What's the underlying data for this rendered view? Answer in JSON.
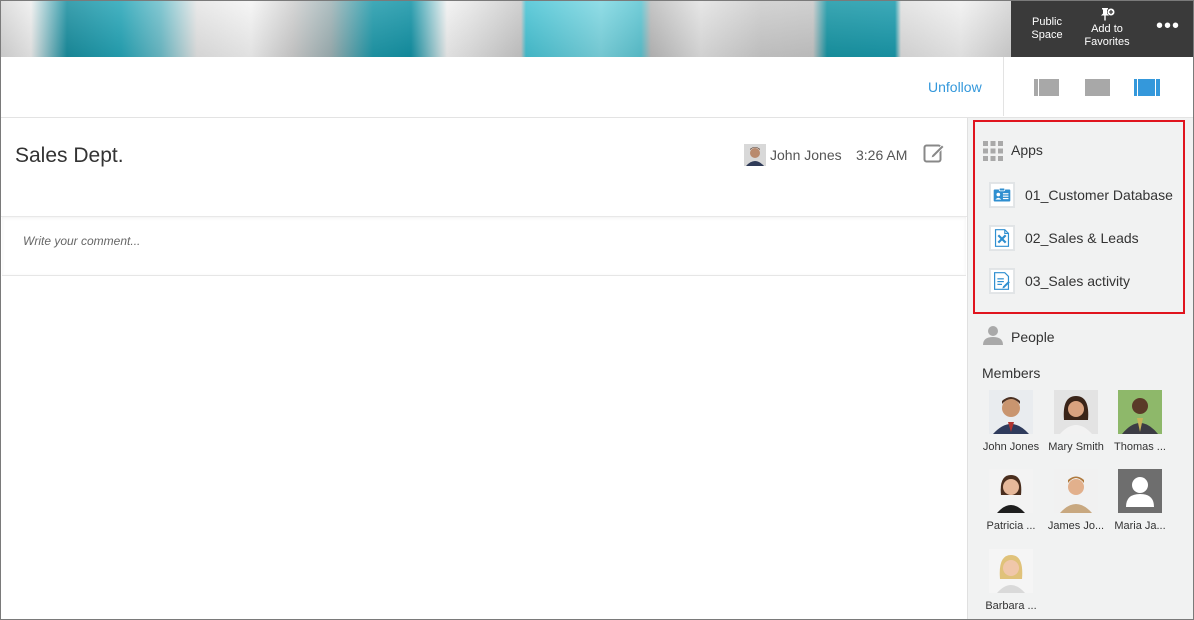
{
  "banner": {
    "public_space": "Public Space",
    "add_to_favorites": "Add to Favorites",
    "more": "•••"
  },
  "toolbar": {
    "unfollow": "Unfollow",
    "layout_icons": [
      "layout-sidebar-left-icon",
      "layout-full-icon",
      "layout-sidebar-right-icon"
    ],
    "accent_color": "#3498db"
  },
  "space": {
    "title": "Sales Dept.",
    "author": "John Jones",
    "time": "3:26 AM",
    "comment_placeholder": "Write your comment..."
  },
  "sidebar": {
    "apps_label": "Apps",
    "apps": [
      {
        "name": "01_Customer Database",
        "icon": "customer-database-icon"
      },
      {
        "name": "02_Sales & Leads",
        "icon": "sales-leads-icon"
      },
      {
        "name": "03_Sales activity",
        "icon": "sales-activity-icon"
      }
    ],
    "people_label": "People",
    "members_label": "Members",
    "members": [
      {
        "name": "John Jones"
      },
      {
        "name": "Mary Smith"
      },
      {
        "name": "Thomas ..."
      },
      {
        "name": "Patricia ..."
      },
      {
        "name": "James Jo..."
      },
      {
        "name": "Maria Ja..."
      },
      {
        "name": "Barbara ..."
      }
    ],
    "highlight_color": "#e0141e"
  }
}
